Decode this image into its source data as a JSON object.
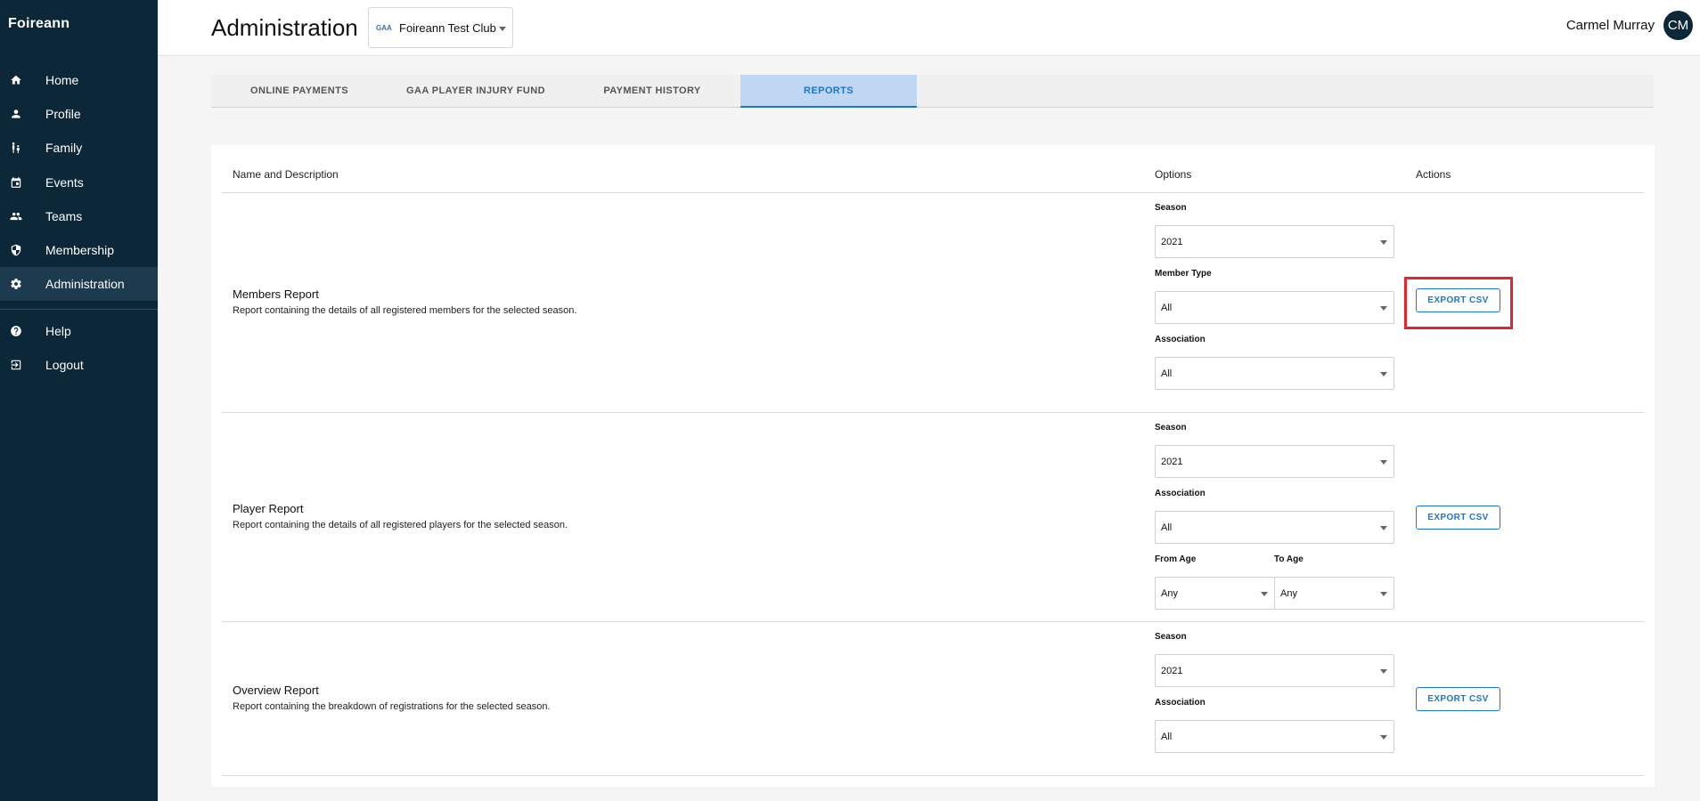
{
  "app": {
    "brand": "Foireann"
  },
  "sidebar": {
    "items": [
      {
        "label": "Home",
        "icon": "home-icon"
      },
      {
        "label": "Profile",
        "icon": "person-icon"
      },
      {
        "label": "Family",
        "icon": "family-icon"
      },
      {
        "label": "Events",
        "icon": "calendar-icon"
      },
      {
        "label": "Teams",
        "icon": "group-icon"
      },
      {
        "label": "Membership",
        "icon": "shield-icon"
      },
      {
        "label": "Administration",
        "icon": "gear-icon",
        "active": true
      },
      {
        "label": "Help",
        "icon": "help-icon"
      },
      {
        "label": "Logout",
        "icon": "logout-icon"
      }
    ]
  },
  "header": {
    "title": "Administration",
    "club": {
      "name": "Foireann Test Club",
      "logo_text": "GAA"
    },
    "user": {
      "name": "Carmel Murray",
      "initials": "CM"
    }
  },
  "tabs": [
    {
      "label": "ONLINE PAYMENTS"
    },
    {
      "label": "GAA PLAYER INJURY FUND"
    },
    {
      "label": "PAYMENT HISTORY"
    },
    {
      "label": "REPORTS",
      "active": true
    }
  ],
  "table": {
    "headers": {
      "name": "Name and Description",
      "options": "Options",
      "actions": "Actions"
    },
    "reports": [
      {
        "name": "Members Report",
        "description": "Report containing the details of all registered members for the selected season.",
        "options": [
          {
            "label": "Season",
            "value": "2021"
          },
          {
            "label": "Member Type",
            "value": "All"
          },
          {
            "label": "Association",
            "value": "All"
          }
        ],
        "action": "EXPORT CSV"
      },
      {
        "name": "Player Report",
        "description": "Report containing the details of all registered players for the selected season.",
        "options": [
          {
            "label": "Season",
            "value": "2021"
          },
          {
            "label": "Association",
            "value": "All"
          },
          {
            "label": "From Age",
            "value": "Any"
          },
          {
            "label": "To Age",
            "value": "Any"
          }
        ],
        "action": "EXPORT CSV"
      },
      {
        "name": "Overview Report",
        "description": "Report containing the breakdown of registrations for the selected season.",
        "options": [
          {
            "label": "Season",
            "value": "2021"
          },
          {
            "label": "Association",
            "value": "All"
          }
        ],
        "action": "EXPORT CSV"
      }
    ]
  },
  "colors": {
    "sidebar_bg": "#0b2738",
    "sidebar_active": "#1d3b4f",
    "accent": "#1976d2",
    "active_tab_bg": "#bfd7f2",
    "highlight": "#e4262c"
  }
}
